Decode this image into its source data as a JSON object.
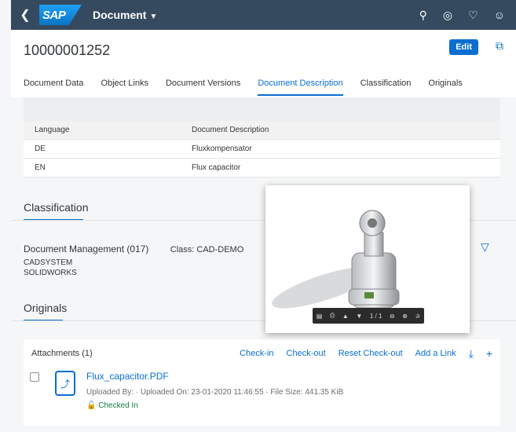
{
  "shell": {
    "logo": "SAP",
    "app_title": "Document",
    "icons": [
      "back-icon",
      "search-icon",
      "copilot-icon",
      "notifications-icon",
      "user-icon"
    ]
  },
  "header": {
    "object_title": "10000001252",
    "edit_label": "Edit"
  },
  "tabs": [
    {
      "label": "Document Data"
    },
    {
      "label": "Object Links"
    },
    {
      "label": "Document Versions"
    },
    {
      "label": "Document Description",
      "active": true
    },
    {
      "label": "Classification"
    },
    {
      "label": "Originals"
    }
  ],
  "descriptions": {
    "columns": [
      "Language",
      "Document Description"
    ],
    "rows": [
      [
        "DE",
        "Fluxkompensator"
      ],
      [
        "EN",
        "Flux capacitor"
      ]
    ]
  },
  "classification": {
    "title": "Classification",
    "name": "Document Management (017)",
    "class_label": "Class: CAD-DEMO",
    "values": [
      "CADSYSTEM",
      "SOLIDWORKS"
    ]
  },
  "originals": {
    "title": "Originals",
    "count_label": "Attachments (1)",
    "actions": [
      "Check-in",
      "Check-out",
      "Reset Check-out",
      "Add a Link"
    ],
    "file": {
      "name": "Flux_capacitor.PDF",
      "meta": "Uploaded By: · Uploaded On: 23-01-2020 11:46:55 · File Size: 441.35 KiB",
      "status": "Checked In"
    }
  },
  "preview": {
    "page_indicator": "1 / 1"
  },
  "colors": {
    "shell": "#354a5f",
    "accent": "#0a6ed1",
    "success": "#107e3e"
  }
}
